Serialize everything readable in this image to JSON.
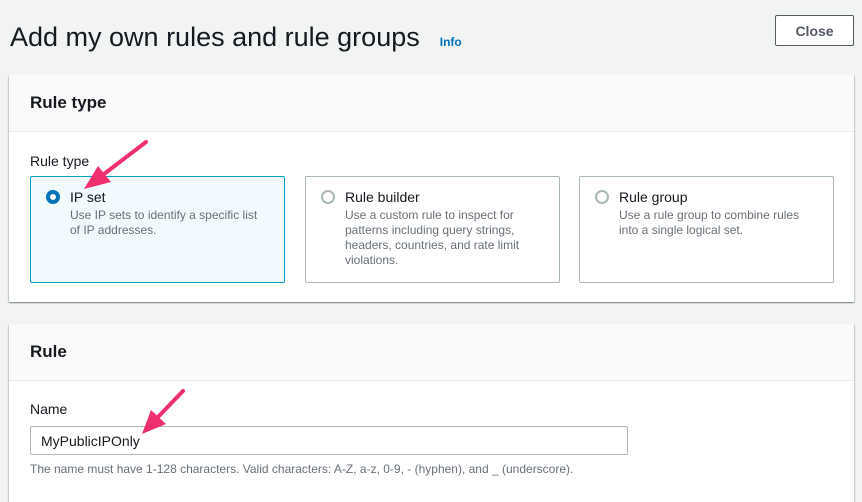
{
  "header": {
    "title": "Add my own rules and rule groups",
    "info_label": "Info",
    "close_label": "Close"
  },
  "rule_type_panel": {
    "heading": "Rule type",
    "field_label": "Rule type",
    "options": [
      {
        "title": "IP set",
        "description": "Use IP sets to identify a specific list of IP addresses.",
        "selected": true
      },
      {
        "title": "Rule builder",
        "description": "Use a custom rule to inspect for patterns including query strings, headers, countries, and rate limit violations.",
        "selected": false
      },
      {
        "title": "Rule group",
        "description": "Use a rule group to combine rules into a single logical set.",
        "selected": false
      }
    ]
  },
  "rule_panel": {
    "heading": "Rule",
    "name_label": "Name",
    "name_value": "MyPublicIPOnly",
    "name_hint": "The name must have 1-128 characters. Valid characters: A-Z, a-z, 0-9, - (hyphen), and _ (underscore)."
  },
  "colors": {
    "accent": "#0073bb",
    "annotation_arrow": "#f0306e",
    "selected_border": "#00a1c9"
  }
}
